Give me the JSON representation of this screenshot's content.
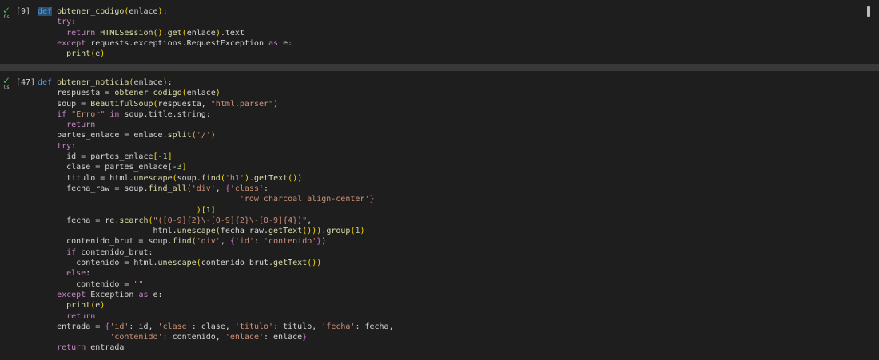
{
  "cells": [
    {
      "exec_count": "[9]",
      "time": "0s",
      "status": "success",
      "lines": [
        "def obtener_codigo(enlace):",
        "    try:",
        "      return HTMLSession().get(enlace).text",
        "    except requests.exceptions.RequestException as e:",
        "      print(e)"
      ]
    },
    {
      "exec_count": "[47]",
      "time": "0s",
      "status": "success",
      "lines": [
        "def obtener_noticia(enlace):",
        "    respuesta = obtener_codigo(enlace)",
        "    soup = BeautifulSoup(respuesta, \"html.parser\")",
        "    if \"Error\" in soup.title.string:",
        "      return",
        "    partes_enlace = enlace.split('/')",
        "    try:",
        "      id = partes_enlace[-1]",
        "      clase = partes_enlace[-3]",
        "      titulo = html.unescape(soup.find('h1').getText())",
        "      fecha_raw = soup.find_all('div', {'class':",
        "                                          'row charcoal align-center'}",
        "                                 )[1]",
        "      fecha = re.search(\"([0-9]{2}\\-[0-9]{2}\\-[0-9]{4})\",",
        "                        html.unescape(fecha_raw.getText())).group(1)",
        "      contenido_brut = soup.find('div', {'id': 'contenido'})",
        "      if contenido_brut:",
        "        contenido = html.unescape(contenido_brut.getText())",
        "      else:",
        "        contenido = \"\"",
        "    except Exception as e:",
        "      print(e)",
        "      return",
        "    entrada = {'id': id, 'clase': clase, 'titulo': titulo, 'fecha': fecha,",
        "               'contenido': contenido, 'enlace': enlace}",
        "    return entrada"
      ]
    }
  ]
}
